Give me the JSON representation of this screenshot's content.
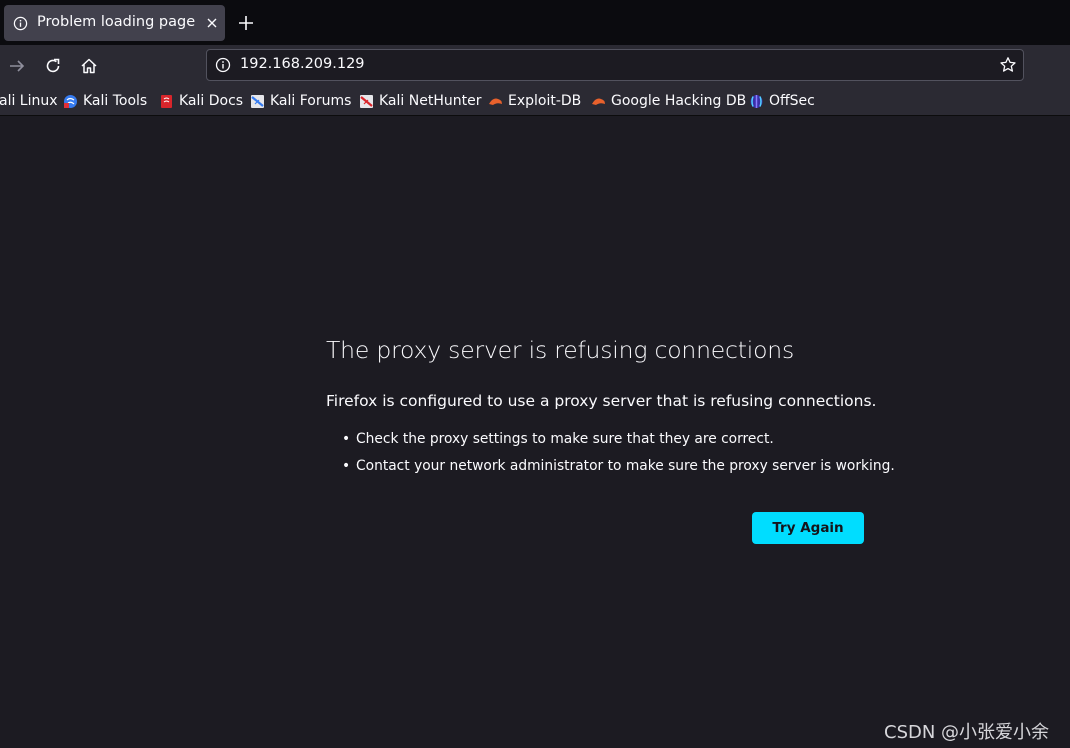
{
  "tab": {
    "title": "Problem loading page",
    "icon": "info-icon"
  },
  "toolbar": {
    "back": "arrow-forward-icon",
    "reload": "reload-icon",
    "home": "home-icon"
  },
  "urlbar": {
    "url": "192.168.209.129"
  },
  "bookmarks": [
    {
      "label": "ali Linux",
      "icon": "kali-icon"
    },
    {
      "label": "Kali Tools",
      "icon": "kali-tools-icon"
    },
    {
      "label": "Kali Docs",
      "icon": "kali-docs-icon"
    },
    {
      "label": "Kali Forums",
      "icon": "kali-forums-icon"
    },
    {
      "label": "Kali NetHunter",
      "icon": "kali-nethunter-icon"
    },
    {
      "label": "Exploit-DB",
      "icon": "exploit-db-icon"
    },
    {
      "label": "Google Hacking DB",
      "icon": "ghdb-icon"
    },
    {
      "label": "OffSec",
      "icon": "offsec-icon"
    }
  ],
  "error": {
    "title": "The proxy server is refusing connections",
    "description": "Firefox is configured to use a proxy server that is refusing connections.",
    "bullets": [
      "Check the proxy settings to make sure that they are correct.",
      "Contact your network administrator to make sure the proxy server is working."
    ],
    "button": "Try Again"
  },
  "watermark": "CSDN @小张爱小余",
  "colors": {
    "accent": "#00ddff",
    "page_bg": "#1c1b22",
    "toolbar_bg": "#2b2a33",
    "tab_bg": "#42414d"
  }
}
